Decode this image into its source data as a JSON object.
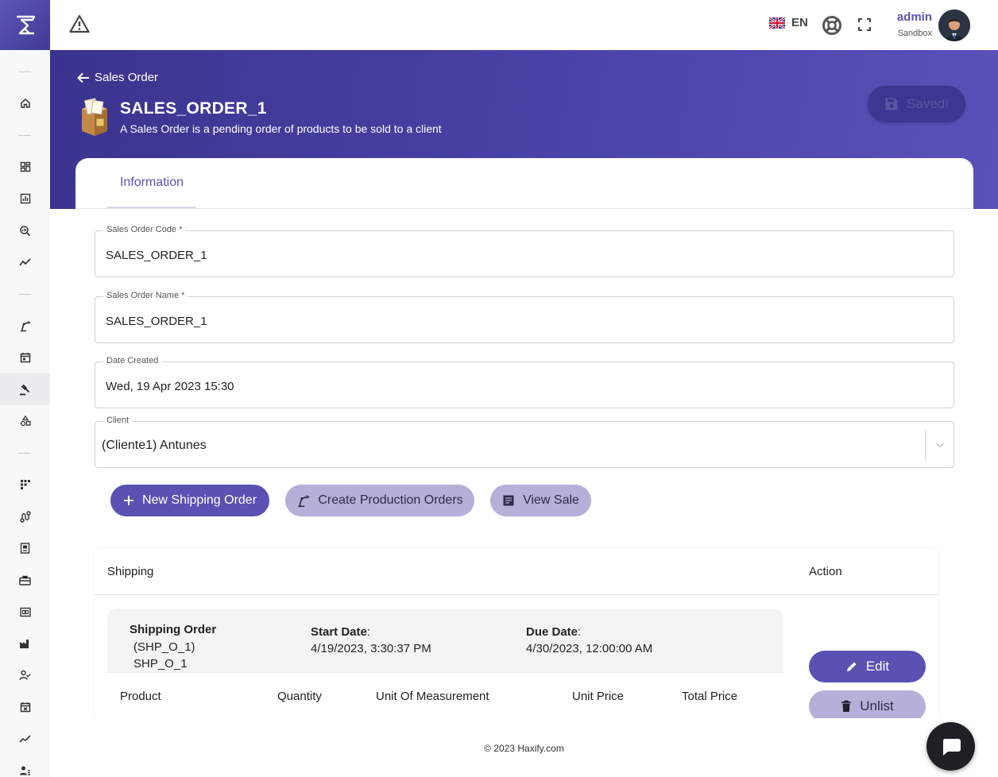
{
  "topbar": {
    "language_code": "EN",
    "user_name": "admin",
    "user_environment": "Sandbox"
  },
  "header": {
    "back_label": "Sales Order",
    "title": "SALES_ORDER_1",
    "description": "A Sales Order is a pending order of products to be sold to a client",
    "save_button_label": "Saved!"
  },
  "tabs": [
    {
      "label": "Information",
      "active": true
    }
  ],
  "form": {
    "sales_order_code": {
      "label": "Sales Order Code *",
      "value": "SALES_ORDER_1"
    },
    "sales_order_name": {
      "label": "Sales Order Name *",
      "value": "SALES_ORDER_1"
    },
    "date_created": {
      "label": "Date Created",
      "value": "Wed, 19 Apr 2023 15:30"
    },
    "client": {
      "label": "Client",
      "value": "(Cliente1) Antunes"
    }
  },
  "actions": {
    "new_shipping_order": "New Shipping Order",
    "create_production_orders": "Create Production Orders",
    "view_sale": "View Sale"
  },
  "shipping_table": {
    "headers": {
      "shipping": "Shipping",
      "action": "Action"
    },
    "rows": [
      {
        "title": "Shipping Order",
        "code": "(SHP_O_1)",
        "name": "SHP_O_1",
        "start_date_label": "Start Date",
        "start_date": "4/19/2023, 3:30:37 PM",
        "due_date_label": "Due Date",
        "due_date": "4/30/2023, 12:00:00 AM",
        "product_columns": [
          "Product",
          "Quantity",
          "Unit Of Measurement",
          "Unit Price",
          "Total Price"
        ],
        "edit_label": "Edit",
        "unlist_label": "Unlist"
      }
    ]
  },
  "footer": {
    "copyright": "© 2023 Haxify.com"
  },
  "colors": {
    "brand": "#5a51b3",
    "header_gradient_start": "#3a348e",
    "header_gradient_end": "#5a52b8",
    "soft_button": "#b5b0d8"
  }
}
